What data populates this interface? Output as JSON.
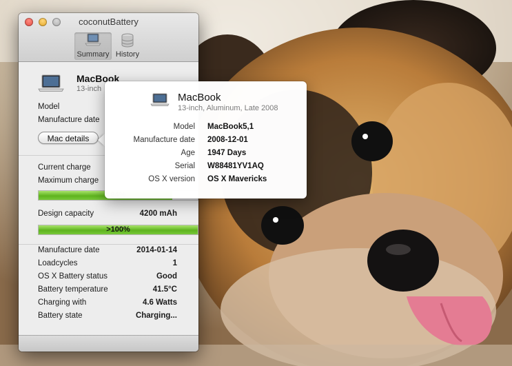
{
  "window": {
    "title": "coconutBattery"
  },
  "toolbar": {
    "items": [
      {
        "label": "Summary",
        "icon": "laptop-icon",
        "selected": true
      },
      {
        "label": "History",
        "icon": "database-icon",
        "selected": false
      }
    ]
  },
  "device": {
    "name": "MacBook",
    "subtitle": "13-inch",
    "fields": [
      {
        "label": "Model"
      },
      {
        "label": "Manufacture date"
      }
    ],
    "details_button": "Mac details"
  },
  "battery": {
    "current_charge_label": "Current charge",
    "maximum_charge_label": "Maximum charge",
    "charge_bar": {
      "text": "84%",
      "percent": 84
    },
    "design_capacity": {
      "label": "Design capacity",
      "value": "4200 mAh"
    },
    "capacity_bar": {
      "text": ">100%",
      "percent": 100
    },
    "rows": [
      {
        "label": "Manufacture date",
        "value": "2014-01-14"
      },
      {
        "label": "Loadcycles",
        "value": "1"
      },
      {
        "label": "OS X Battery status",
        "value": "Good"
      },
      {
        "label": "Battery temperature",
        "value": "41.5°C"
      },
      {
        "label": "Charging with",
        "value": "4.6 Watts"
      },
      {
        "label": "Battery state",
        "value": "Charging..."
      }
    ]
  },
  "popover": {
    "title": "MacBook",
    "subtitle": "13-inch, Aluminum, Late 2008",
    "rows": [
      {
        "label": "Model",
        "value": "MacBook5,1"
      },
      {
        "label": "Manufacture date",
        "value": "2008-12-01"
      },
      {
        "label": "Age",
        "value": "1947 Days"
      },
      {
        "label": "Serial",
        "value": "W88481YV1AQ"
      },
      {
        "label": "OS X version",
        "value": "OS X Mavericks"
      }
    ]
  }
}
